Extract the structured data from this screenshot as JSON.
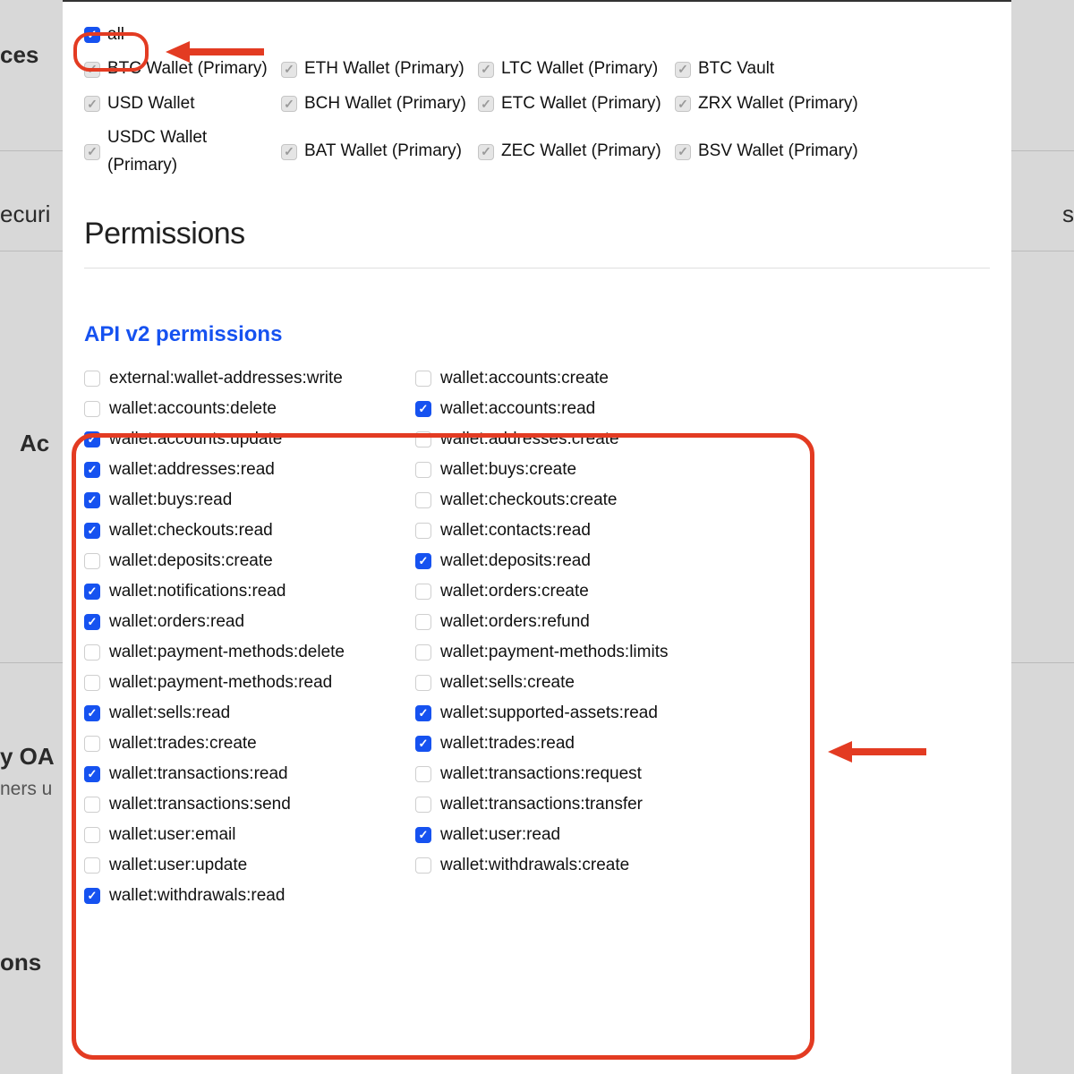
{
  "background": {
    "text1": "ces",
    "text2": "ecuri",
    "text3": "s",
    "text4": "Ac",
    "text5": "y OA",
    "text6": "ners u",
    "text7": "ons"
  },
  "accounts": {
    "all_label": "all",
    "items": [
      {
        "label": "BTC Wallet (Primary)",
        "checked": true
      },
      {
        "label": "ETH Wallet (Primary)",
        "checked": true
      },
      {
        "label": "LTC Wallet (Primary)",
        "checked": true
      },
      {
        "label": "BTC Vault",
        "checked": true
      },
      {
        "label": "USD Wallet",
        "checked": true
      },
      {
        "label": "BCH Wallet (Primary)",
        "checked": true
      },
      {
        "label": "ETC Wallet (Primary)",
        "checked": true
      },
      {
        "label": "ZRX Wallet (Primary)",
        "checked": true
      },
      {
        "label": "USDC Wallet (Primary)",
        "checked": true
      },
      {
        "label": "BAT Wallet (Primary)",
        "checked": true
      },
      {
        "label": "ZEC Wallet (Primary)",
        "checked": true
      },
      {
        "label": "BSV Wallet (Primary)",
        "checked": true
      }
    ]
  },
  "permissions_heading": "Permissions",
  "api_heading": "API v2 permissions",
  "permissions": [
    {
      "label": "external:wallet-addresses:write",
      "checked": false
    },
    {
      "label": "wallet:accounts:create",
      "checked": false
    },
    {
      "label": "wallet:accounts:delete",
      "checked": false
    },
    {
      "label": "wallet:accounts:read",
      "checked": true
    },
    {
      "label": "wallet:accounts:update",
      "checked": true
    },
    {
      "label": "wallet:addresses:create",
      "checked": false
    },
    {
      "label": "wallet:addresses:read",
      "checked": true
    },
    {
      "label": "wallet:buys:create",
      "checked": false
    },
    {
      "label": "wallet:buys:read",
      "checked": true
    },
    {
      "label": "wallet:checkouts:create",
      "checked": false
    },
    {
      "label": "wallet:checkouts:read",
      "checked": true
    },
    {
      "label": "wallet:contacts:read",
      "checked": false
    },
    {
      "label": "wallet:deposits:create",
      "checked": false
    },
    {
      "label": "wallet:deposits:read",
      "checked": true
    },
    {
      "label": "wallet:notifications:read",
      "checked": true
    },
    {
      "label": "wallet:orders:create",
      "checked": false
    },
    {
      "label": "wallet:orders:read",
      "checked": true
    },
    {
      "label": "wallet:orders:refund",
      "checked": false
    },
    {
      "label": "wallet:payment-methods:delete",
      "checked": false
    },
    {
      "label": "wallet:payment-methods:limits",
      "checked": false
    },
    {
      "label": "wallet:payment-methods:read",
      "checked": false
    },
    {
      "label": "wallet:sells:create",
      "checked": false
    },
    {
      "label": "wallet:sells:read",
      "checked": true
    },
    {
      "label": "wallet:supported-assets:read",
      "checked": true
    },
    {
      "label": "wallet:trades:create",
      "checked": false
    },
    {
      "label": "wallet:trades:read",
      "checked": true
    },
    {
      "label": "wallet:transactions:read",
      "checked": true
    },
    {
      "label": "wallet:transactions:request",
      "checked": false
    },
    {
      "label": "wallet:transactions:send",
      "checked": false
    },
    {
      "label": "wallet:transactions:transfer",
      "checked": false
    },
    {
      "label": "wallet:user:email",
      "checked": false
    },
    {
      "label": "wallet:user:read",
      "checked": true
    },
    {
      "label": "wallet:user:update",
      "checked": false
    },
    {
      "label": "wallet:withdrawals:create",
      "checked": false
    },
    {
      "label": "wallet:withdrawals:read",
      "checked": true
    }
  ]
}
